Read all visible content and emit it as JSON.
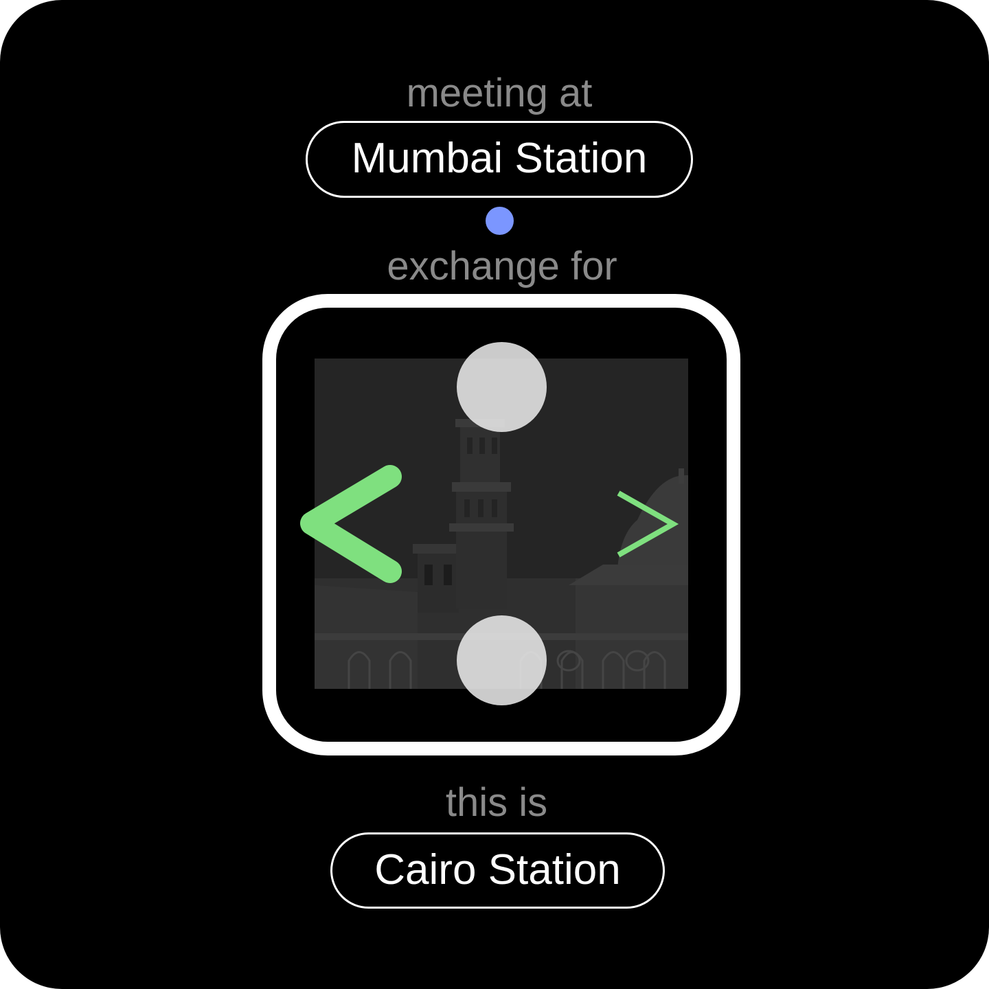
{
  "meeting": {
    "caption": "meeting at",
    "station": "Mumbai Station"
  },
  "exchange": {
    "caption": "exchange for",
    "indicator_color": "#7b96ff"
  },
  "picker": {
    "photo_icon": "mosque-minaret-photo",
    "prev_icon": "chevron-left-icon",
    "next_icon": "chevron-right-icon",
    "accent_color": "#7fe07f",
    "frame_color": "#ffffff"
  },
  "current": {
    "caption": "this is",
    "station": "Cairo Station"
  }
}
